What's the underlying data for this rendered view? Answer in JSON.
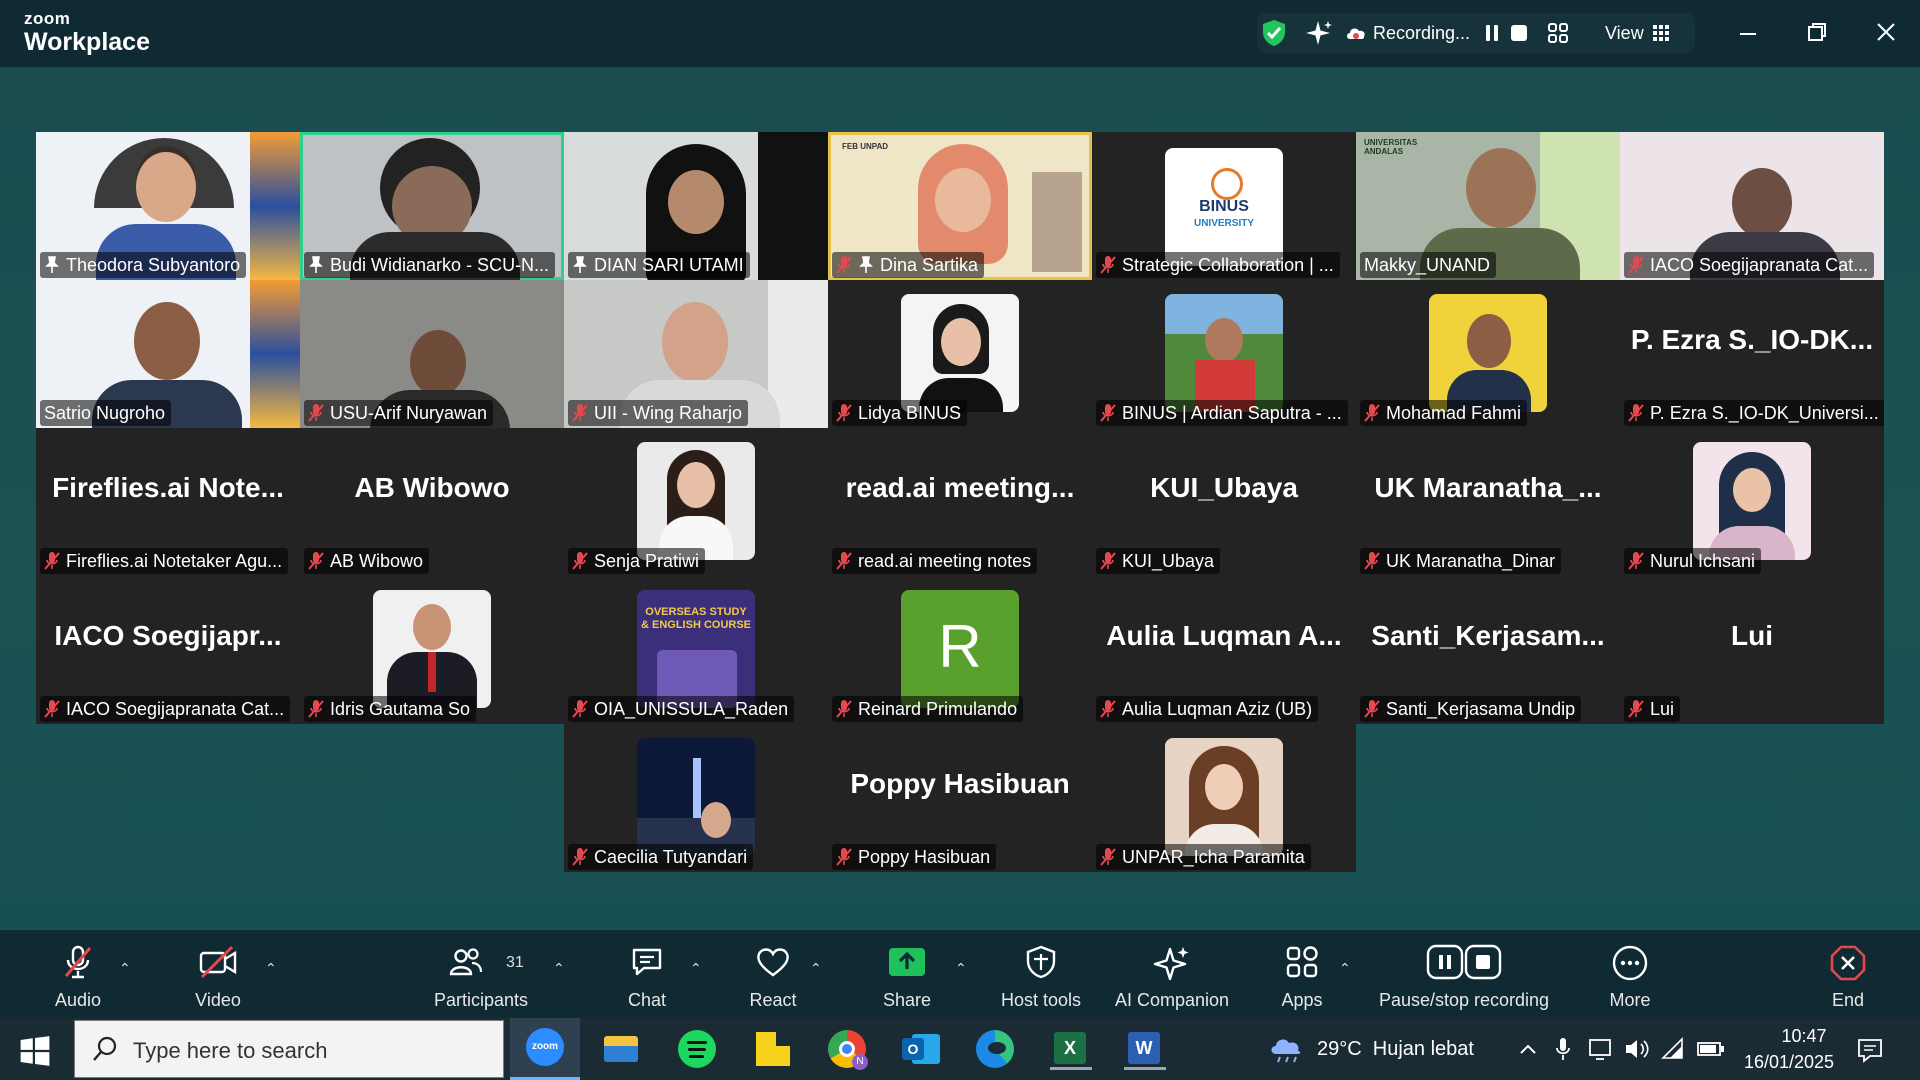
{
  "app": {
    "brand_small": "zoom",
    "brand_large": "Workplace"
  },
  "titlebar": {
    "recording_label": "Recording...",
    "view_label": "View"
  },
  "participants": [
    {
      "name": "Theodora Subyantoro",
      "display": "",
      "muted": false,
      "pinned": true
    },
    {
      "name": "Budi Widianarko - SCU-N...",
      "display": "",
      "muted": false,
      "pinned": true,
      "active": true
    },
    {
      "name": "DIAN SARI UTAMI",
      "display": "",
      "muted": false,
      "pinned": true
    },
    {
      "name": "Dina Sartika",
      "display": "",
      "muted": true,
      "pinned": true,
      "spotlight": true
    },
    {
      "name": "Strategic Collaboration | ...",
      "display": "",
      "muted": true
    },
    {
      "name": "Makky_UNAND",
      "display": "",
      "muted": false
    },
    {
      "name": "IACO Soegijapranata Cat...",
      "display": "",
      "muted": true
    },
    {
      "name": "Satrio Nugroho",
      "display": "",
      "muted": false
    },
    {
      "name": "USU-Arif Nuryawan",
      "display": "",
      "muted": true
    },
    {
      "name": "UII - Wing Raharjo",
      "display": "",
      "muted": true
    },
    {
      "name": "Lidya BINUS",
      "display": "",
      "muted": true
    },
    {
      "name": "BINUS | Ardian Saputra - ...",
      "display": "",
      "muted": true
    },
    {
      "name": "Mohamad Fahmi",
      "display": "",
      "muted": true
    },
    {
      "name": "P. Ezra S._IO-DK_Universi...",
      "display": "P. Ezra S._IO-DK...",
      "muted": true
    },
    {
      "name": "Fireflies.ai Notetaker Agu...",
      "display": "Fireflies.ai Note...",
      "muted": true
    },
    {
      "name": "AB Wibowo",
      "display": "AB Wibowo",
      "muted": true
    },
    {
      "name": "Senja Pratiwi",
      "display": "",
      "muted": true
    },
    {
      "name": "read.ai meeting notes",
      "display": "read.ai meeting...",
      "muted": true
    },
    {
      "name": "KUI_Ubaya",
      "display": "KUI_Ubaya",
      "muted": true
    },
    {
      "name": "UK Maranatha_Dinar",
      "display": "UK Maranatha_...",
      "muted": true
    },
    {
      "name": "Nurul Ichsani",
      "display": "",
      "muted": true
    },
    {
      "name": "IACO Soegijapranata Cat...",
      "display": "IACO Soegijapr...",
      "muted": true
    },
    {
      "name": "Idris Gautama So",
      "display": "",
      "muted": true
    },
    {
      "name": "OIA_UNISSULA_Raden",
      "display": "",
      "muted": true
    },
    {
      "name": "Reinard Primulando",
      "display": "",
      "muted": true,
      "avatar_letter": "R"
    },
    {
      "name": "Aulia Luqman Aziz (UB)",
      "display": "Aulia Luqman A...",
      "muted": true
    },
    {
      "name": "Santi_Kerjasama Undip",
      "display": "Santi_Kerjasam...",
      "muted": true
    },
    {
      "name": "Lui",
      "display": "Lui",
      "muted": true
    },
    {
      "name": "Caecilia Tutyandari",
      "display": "",
      "muted": true
    },
    {
      "name": "Poppy Hasibuan",
      "display": "Poppy Hasibuan",
      "muted": true
    },
    {
      "name": "UNPAR_Icha Paramita",
      "display": "",
      "muted": true
    }
  ],
  "tile_text": {
    "binus_logo": "BINUS",
    "binus_logo_sub": "UNIVERSITY",
    "feb_unpad": "FEB UNPAD",
    "unand": "UNIVERSITAS ANDALAS",
    "overseas": "OVERSEAS STUDY & ENGLISH COURSE"
  },
  "toolbar": {
    "audio": "Audio",
    "video": "Video",
    "participants": "Participants",
    "participants_count": "31",
    "chat": "Chat",
    "react": "React",
    "share": "Share",
    "host_tools": "Host tools",
    "ai_companion": "AI Companion",
    "apps": "Apps",
    "pause_stop": "Pause/stop recording",
    "more": "More",
    "end": "End"
  },
  "taskbar": {
    "search_placeholder": "Type here to search",
    "weather": "29°C  Hujan lebat",
    "time": "10:47",
    "date": "16/01/2025"
  },
  "colors": {
    "accent_green": "#2fd08a",
    "mute_red": "#e5484d",
    "share_green": "#1fc15c",
    "end_red": "#e5484d"
  }
}
